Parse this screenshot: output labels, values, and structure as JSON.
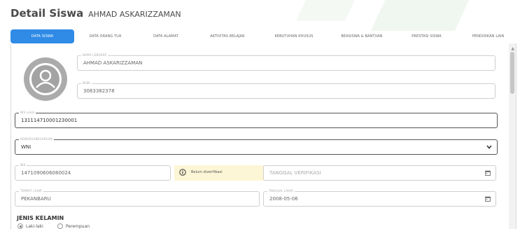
{
  "page": {
    "title": "Detail Siswa",
    "student_name": "AHMAD ASKARIZZAMAN"
  },
  "tabs": [
    {
      "label": "DATA SISWA",
      "active": true
    },
    {
      "label": "DATA ORANG TUA",
      "active": false
    },
    {
      "label": "DATA ALAMAT",
      "active": false
    },
    {
      "label": "AKTIVITAS BELAJAR",
      "active": false
    },
    {
      "label": "KEBUTUHAN KHUSUS",
      "active": false
    },
    {
      "label": "BEASISWA & BANTUAN",
      "active": false
    },
    {
      "label": "PRESTASI SISWA",
      "active": false
    },
    {
      "label": "PENDIDIKAN LAIN",
      "active": false
    }
  ],
  "form": {
    "nama_lengkap": {
      "label": "NAMA LENGKAP",
      "value": "AHMAD ASKARIZZAMAN"
    },
    "nisn": {
      "label": "NISN",
      "value": "3083382378"
    },
    "nis_lokal": {
      "label": "NIS Lokal",
      "value": "131114710001230001"
    },
    "kewarganegaraan": {
      "label": "KEWARGANEGARAAN",
      "value": "WNI"
    },
    "nik": {
      "label": "NIK",
      "value": "1471090606080024"
    },
    "verification_status": "Belum diverifikasi",
    "tanggal_verifikasi": {
      "placeholder": "TANGGAL VERIFIKASI"
    },
    "tempat_lahir": {
      "label": "TEMPAT LAHIR",
      "value": "PEKANBARU"
    },
    "tanggal_lahir": {
      "label": "TANGGAL LAHIR",
      "value": "2008-05-06"
    },
    "jenis_kelamin": {
      "title": "JENIS KELAMIN",
      "options": [
        {
          "label": "Laki-laki",
          "checked": true
        },
        {
          "label": "Perempuan",
          "checked": false
        }
      ]
    }
  },
  "colors": {
    "accent": "#2f8be6",
    "verify_bg": "#fdf6d6",
    "avatar_bg": "#ababab"
  },
  "icons": {
    "avatar": "user-avatar-icon",
    "info": "info-circle-icon",
    "calendar": "calendar-icon",
    "dropdown": "chevron-down-icon"
  }
}
